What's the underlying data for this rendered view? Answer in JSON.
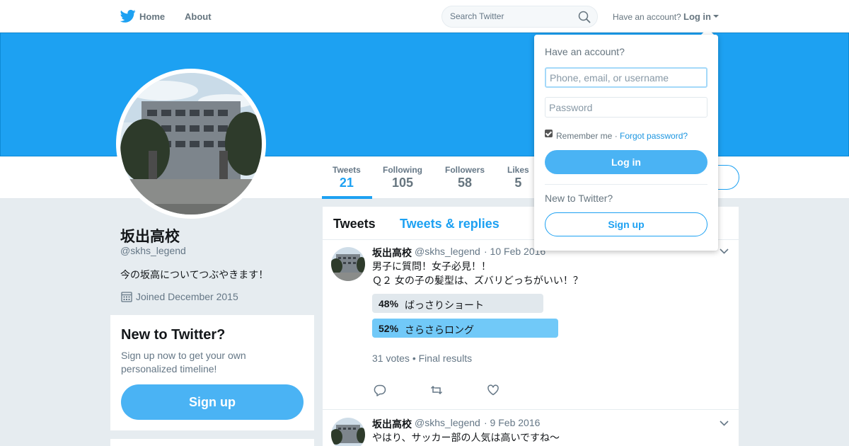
{
  "topnav": {
    "home_label": "Home",
    "about_label": "About",
    "search_placeholder": "Search Twitter",
    "have_account": "Have an account?",
    "login_label": "Log in"
  },
  "profile_nav": {
    "stats": [
      {
        "label": "Tweets",
        "value": "21",
        "active": true
      },
      {
        "label": "Following",
        "value": "105"
      },
      {
        "label": "Followers",
        "value": "58"
      },
      {
        "label": "Likes",
        "value": "5"
      }
    ]
  },
  "profile": {
    "name": "坂出高校",
    "handle": "@skhs_legend",
    "bio": "今の坂高についてつぶやきます！",
    "joined": "Joined December 2015"
  },
  "signup_card": {
    "title": "New to Twitter?",
    "text": "Sign up now to get your own personalized timeline!",
    "button": "Sign up"
  },
  "timeline": {
    "tabs": [
      "Tweets",
      "Tweets & replies"
    ],
    "tweets": [
      {
        "name": "坂出高校",
        "handle": "@skhs_legend",
        "date": "· 10 Feb 2016",
        "lines": [
          "男子に質問！女子必見！！",
          "Ｑ２ 女の子の髪型は、ズバリどっちがいい！？"
        ],
        "poll": {
          "options": [
            {
              "percent": "48%",
              "label": "ばっさりショート",
              "share": 0.48,
              "winner": false
            },
            {
              "percent": "52%",
              "label": "さらさらロング",
              "share": 0.52,
              "winner": true
            }
          ],
          "votes": "31 votes",
          "status": "Final results"
        }
      },
      {
        "name": "坂出高校",
        "handle": "@skhs_legend",
        "date": "· 9 Feb 2016",
        "lines": [
          "やはり、サッカー部の人気は高いですね〜"
        ]
      }
    ]
  },
  "login_dropdown": {
    "title": "Have an account?",
    "username_placeholder": "Phone, email, or username",
    "password_placeholder": "Password",
    "remember": "Remember me",
    "separator": "·",
    "forgot": "Forgot password?",
    "login_button": "Log in",
    "new_text": "New to Twitter?",
    "signup_button": "Sign up"
  },
  "colors": {
    "brand": "#1da1f2",
    "button": "#4ab3f4",
    "poll_loser": "#e1e8ed",
    "poll_winner": "#71c9f8"
  }
}
